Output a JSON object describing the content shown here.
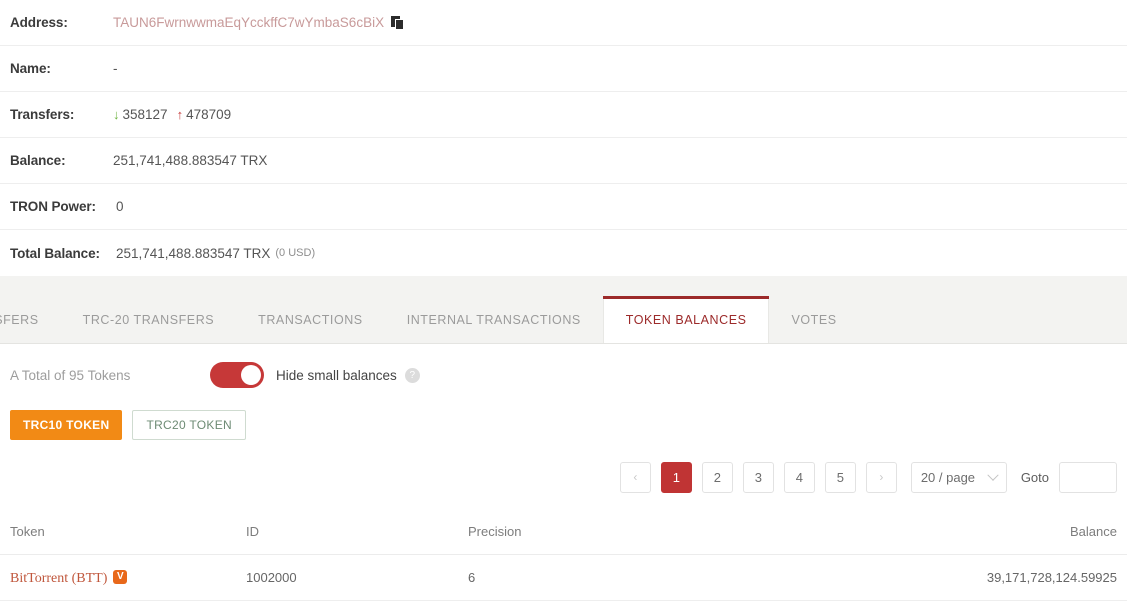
{
  "account_info": {
    "rows": [
      {
        "label": "Address:",
        "type": "address",
        "value": "TAUN6FwrnwwmaEqYcckffC7wYmbaS6cBiX",
        "copy_icon": "copy-icon"
      },
      {
        "label": "Name:",
        "type": "text",
        "value": "-"
      },
      {
        "label": "Transfers:",
        "type": "transfers",
        "in_icon": "arrow-down-icon",
        "in_count": "358127",
        "out_icon": "arrow-up-icon",
        "out_count": "478709"
      },
      {
        "label": "Balance:",
        "type": "text",
        "value": "251,741,488.883547 TRX"
      },
      {
        "label": "TRON Power:",
        "type": "text",
        "value": "0"
      },
      {
        "label": "Total Balance:",
        "type": "total",
        "value": "251,741,488.883547 TRX",
        "usd": "(0 USD)"
      }
    ]
  },
  "tabs": [
    {
      "label": "TRANSFERS",
      "active": false
    },
    {
      "label": "TRC-20 TRANSFERS",
      "active": false
    },
    {
      "label": "TRANSACTIONS",
      "active": false
    },
    {
      "label": "INTERNAL TRANSACTIONS",
      "active": false
    },
    {
      "label": "TOKEN BALANCES",
      "active": true
    },
    {
      "label": "VOTES",
      "active": false
    }
  ],
  "controls": {
    "total_text": "A Total of 95 Tokens",
    "toggle_on": true,
    "toggle_label": "Hide small balances",
    "help_icon": "question-mark-icon",
    "help_glyph": "?",
    "trc10_label": "TRC10 TOKEN",
    "trc20_label": "TRC20 TOKEN"
  },
  "pagination": {
    "prev_glyph": "‹",
    "next_glyph": "›",
    "pages": [
      "1",
      "2",
      "3",
      "4",
      "5"
    ],
    "current": "1",
    "page_size": "20 / page",
    "goto_label": "Goto",
    "goto_value": "",
    "goto_placeholder": ""
  },
  "token_table": {
    "headers": {
      "token": "Token",
      "id": "ID",
      "precision": "Precision",
      "balance": "Balance"
    },
    "rows": [
      {
        "token": "BitTorrent (BTT)",
        "verified": true,
        "verified_glyph": "V",
        "id": "1002000",
        "precision": "6",
        "balance": "39,171,728,124.59925"
      }
    ]
  },
  "colors": {
    "accent_red": "#c03434",
    "tab_active": "#9c2a2a",
    "orange": "#f28a15",
    "link": "#c0573c",
    "in_green": "#6cb33f",
    "out_red": "#c63e3e"
  }
}
